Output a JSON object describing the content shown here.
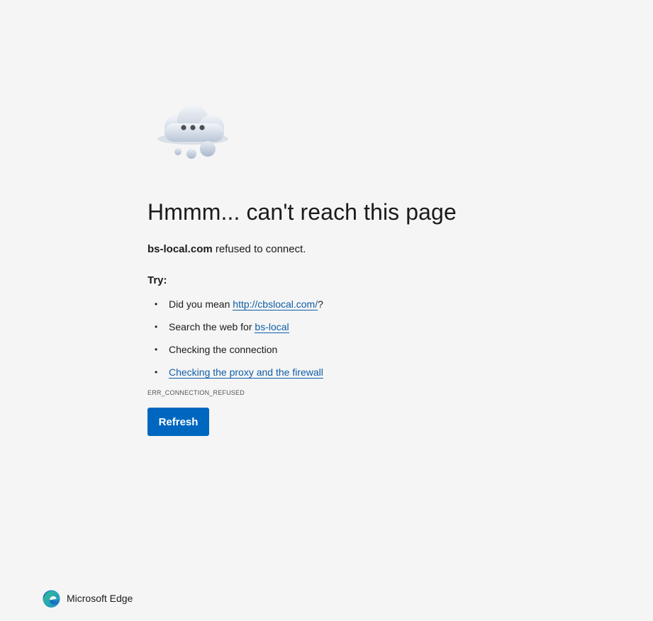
{
  "error_page": {
    "title": "Hmmm... can't reach this page",
    "host": "bs-local.com",
    "host_suffix": " refused to connect.",
    "try_label": "Try:",
    "suggestions": [
      {
        "prefix": "Did you mean ",
        "link": "http://cbslocal.com/",
        "suffix": "?"
      },
      {
        "prefix": "Search the web for ",
        "link": "bs-local",
        "suffix": ""
      },
      {
        "prefix": "Checking the connection",
        "link": "",
        "suffix": ""
      },
      {
        "prefix": "",
        "link": "Checking the proxy and the firewall",
        "suffix": ""
      }
    ],
    "error_code": "ERR_CONNECTION_REFUSED",
    "refresh_label": "Refresh"
  },
  "footer": {
    "brand": "Microsoft Edge"
  },
  "icons": {
    "illustration": "cloud-thinking-icon",
    "logo": "edge-logo-icon"
  },
  "colors": {
    "background": "#f5f5f5",
    "link": "#0f5da8",
    "button": "#0067c0"
  }
}
